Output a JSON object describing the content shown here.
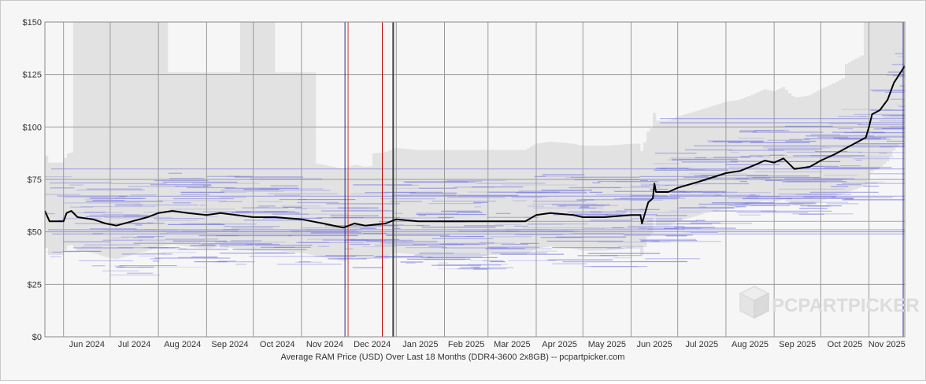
{
  "chart_data": {
    "type": "line",
    "title": "Average RAM Price (USD) Over Last 18 Months (DDR4-3600 2x8GB) -- pcpartpicker.com",
    "xlabel": "",
    "ylabel": "",
    "ylim": [
      0,
      150
    ],
    "yticks": [
      0,
      25,
      50,
      75,
      100,
      125,
      150
    ],
    "ytick_labels": [
      "$0",
      "$25",
      "$50",
      "$75",
      "$100",
      "$125",
      "$150"
    ],
    "x_start": "2024-05-20",
    "x_end": "2025-11-24",
    "month_boundaries": [
      "2024-06-01",
      "2024-07-01",
      "2024-08-01",
      "2024-09-01",
      "2024-10-01",
      "2024-11-01",
      "2024-12-01",
      "2025-01-01",
      "2025-02-01",
      "2025-03-01",
      "2025-04-01",
      "2025-05-01",
      "2025-06-01",
      "2025-07-01",
      "2025-08-01",
      "2025-09-01",
      "2025-10-01",
      "2025-11-01"
    ],
    "month_labels": [
      "Jun 2024",
      "Jul 2024",
      "Aug 2024",
      "Sep 2024",
      "Oct 2024",
      "Nov 2024",
      "Dec 2024",
      "Jan 2025",
      "Feb 2025",
      "Mar 2025",
      "Apr 2025",
      "May 2025",
      "Jun 2025",
      "Jul 2025",
      "Aug 2025",
      "Sep 2025",
      "Oct 2025",
      "Nov 2025"
    ],
    "event_lines": [
      {
        "date": "2024-11-29",
        "color": "#2a2a9a"
      },
      {
        "date": "2024-12-01",
        "color": "#d04040"
      },
      {
        "date": "2024-12-23",
        "color": "#c00000"
      },
      {
        "date": "2024-12-30",
        "color": "#444444"
      },
      {
        "date": "2025-11-23",
        "color": "#2a2a9a"
      }
    ],
    "series": [
      {
        "name": "",
        "color": "#000000",
        "points": [
          [
            "2024-05-20",
            60
          ],
          [
            "2024-05-23",
            55
          ],
          [
            "2024-06-01",
            55
          ],
          [
            "2024-06-03",
            59
          ],
          [
            "2024-06-06",
            60
          ],
          [
            "2024-06-10",
            57
          ],
          [
            "2024-06-20",
            56
          ],
          [
            "2024-06-28",
            54
          ],
          [
            "2024-07-05",
            53
          ],
          [
            "2024-07-15",
            55
          ],
          [
            "2024-07-25",
            57
          ],
          [
            "2024-08-01",
            59
          ],
          [
            "2024-08-10",
            60
          ],
          [
            "2024-08-20",
            59
          ],
          [
            "2024-09-01",
            58
          ],
          [
            "2024-09-10",
            59
          ],
          [
            "2024-09-20",
            58
          ],
          [
            "2024-10-01",
            57
          ],
          [
            "2024-10-15",
            57
          ],
          [
            "2024-11-01",
            56
          ],
          [
            "2024-11-15",
            54
          ],
          [
            "2024-11-28",
            52
          ],
          [
            "2024-12-05",
            54
          ],
          [
            "2024-12-12",
            53
          ],
          [
            "2024-12-25",
            54
          ],
          [
            "2025-01-01",
            56
          ],
          [
            "2025-01-15",
            55
          ],
          [
            "2025-02-01",
            55
          ],
          [
            "2025-02-15",
            55
          ],
          [
            "2025-03-01",
            55
          ],
          [
            "2025-03-25",
            55
          ],
          [
            "2025-04-01",
            58
          ],
          [
            "2025-04-10",
            59
          ],
          [
            "2025-04-25",
            58
          ],
          [
            "2025-05-01",
            57
          ],
          [
            "2025-05-15",
            57
          ],
          [
            "2025-06-01",
            58
          ],
          [
            "2025-06-07",
            58
          ],
          [
            "2025-06-08",
            54
          ],
          [
            "2025-06-12",
            64
          ],
          [
            "2025-06-15",
            66
          ],
          [
            "2025-06-16",
            73
          ],
          [
            "2025-06-17",
            69
          ],
          [
            "2025-06-25",
            69
          ],
          [
            "2025-07-01",
            71
          ],
          [
            "2025-07-15",
            74
          ],
          [
            "2025-08-01",
            78
          ],
          [
            "2025-08-10",
            79
          ],
          [
            "2025-08-20",
            82
          ],
          [
            "2025-08-26",
            84
          ],
          [
            "2025-09-01",
            83
          ],
          [
            "2025-09-07",
            85
          ],
          [
            "2025-09-14",
            80
          ],
          [
            "2025-09-24",
            81
          ],
          [
            "2025-10-01",
            84
          ],
          [
            "2025-10-10",
            87
          ],
          [
            "2025-10-20",
            91
          ],
          [
            "2025-10-25",
            93
          ],
          [
            "2025-10-30",
            95
          ],
          [
            "2025-11-01",
            100
          ],
          [
            "2025-11-03",
            106
          ],
          [
            "2025-11-08",
            108
          ],
          [
            "2025-11-13",
            113
          ],
          [
            "2025-11-17",
            121
          ],
          [
            "2025-11-24",
            129
          ]
        ]
      }
    ],
    "grid": true,
    "legend": "none"
  },
  "colors": {
    "panel": "#f6f6f6",
    "band": "#e2e2e2",
    "listing_lines": "#7070e0",
    "grid": "#9a9a9a",
    "axis_text": "#333333"
  },
  "watermark": {
    "text": "PCPARTPICKER"
  }
}
